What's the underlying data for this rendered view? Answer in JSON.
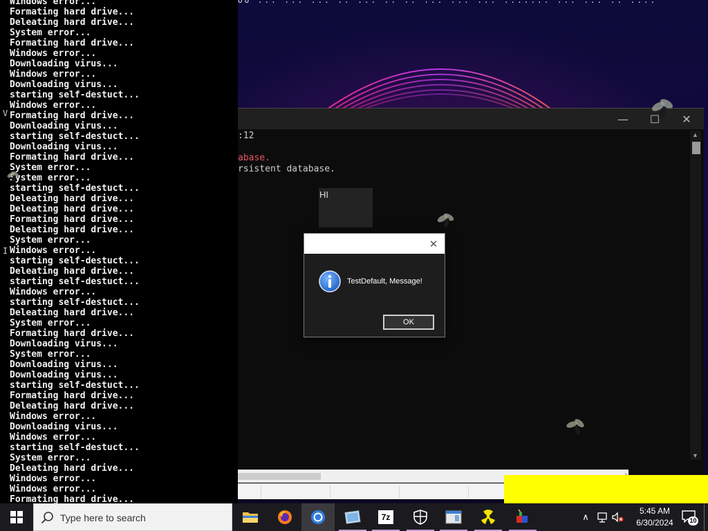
{
  "desktop": {
    "top_text_row": "oo   ... ... ... .. ... .. .. ... ... ... ....... ... ... .. ...."
  },
  "left_console": {
    "lines": [
      "Windows error...",
      "Formating hard drive...",
      "Deleating hard drive...",
      "System error...",
      "Formating hard drive...",
      "Windows error...",
      "Downloading virus...",
      "Windows error...",
      "Downloading virus...",
      "starting self-destuct...",
      "Windows error...",
      "Formating hard drive...",
      "Downloading virus...",
      "starting self-destuct...",
      "Downloading virus...",
      "Formating hard drive...",
      "System error...",
      "System error...",
      "starting self-destuct...",
      "Deleating hard drive...",
      "Deleating hard drive...",
      "Formating hard drive...",
      "Deleating hard drive...",
      "System error...",
      "Windows error...",
      "starting self-destuct...",
      "Deleating hard drive...",
      "starting self-destuct...",
      "Windows error...",
      "starting self-destuct...",
      "Deleating hard drive...",
      "System error...",
      "Formating hard drive...",
      "Downloading virus...",
      "System error...",
      "Downloading virus...",
      "Downloading virus...",
      "starting self-destuct...",
      "Formating hard drive...",
      "Deleating hard drive...",
      "Windows error...",
      "Downloading virus...",
      "Windows error...",
      "starting self-destuct...",
      "System error...",
      "Deleating hard drive...",
      "Windows error...",
      "Windows error...",
      "Formating hard drive..."
    ],
    "edge_glyphs": [
      "V",
      "I"
    ]
  },
  "app_window": {
    "min_glyph": "—",
    "max_glyph": "☐",
    "close_glyph": "✕",
    "content_lines": [
      {
        "text": ":12",
        "style": "normal"
      },
      {
        "text": "abase.",
        "style": "red"
      },
      {
        "text": "rsistent database.",
        "style": "normal"
      }
    ],
    "hi_box_text": "HI"
  },
  "message_box": {
    "message": "TestDefault, Message!",
    "ok_label": "OK",
    "close_glyph": "✕",
    "icon": "info-icon"
  },
  "taskbar": {
    "search_placeholder": "Type here to search",
    "apps": [
      {
        "name": "file-explorer",
        "icon": "folder-icon"
      },
      {
        "name": "firefox",
        "icon": "firefox-icon"
      },
      {
        "name": "chromium",
        "icon": "chromium-icon"
      },
      {
        "name": "image-viewer",
        "icon": "photo-icon"
      },
      {
        "name": "7zip",
        "icon": "7zip-icon",
        "label": "7z"
      },
      {
        "name": "windows-security",
        "icon": "shield-icon"
      },
      {
        "name": "task-manager",
        "icon": "window-icon"
      },
      {
        "name": "radiation-app",
        "icon": "radiation-icon"
      },
      {
        "name": "bomb-app",
        "icon": "bomb-icon"
      }
    ],
    "tray": {
      "time": "5:45 AM",
      "date": "6/30/2024",
      "notification_count": "10",
      "chevron": "∧"
    }
  },
  "colors": {
    "taskbar_bg": "#1b1b1f",
    "console_bg": "#0c0c0c",
    "highlight_yellow": "#ffff00",
    "error_red": "#e7555f"
  }
}
